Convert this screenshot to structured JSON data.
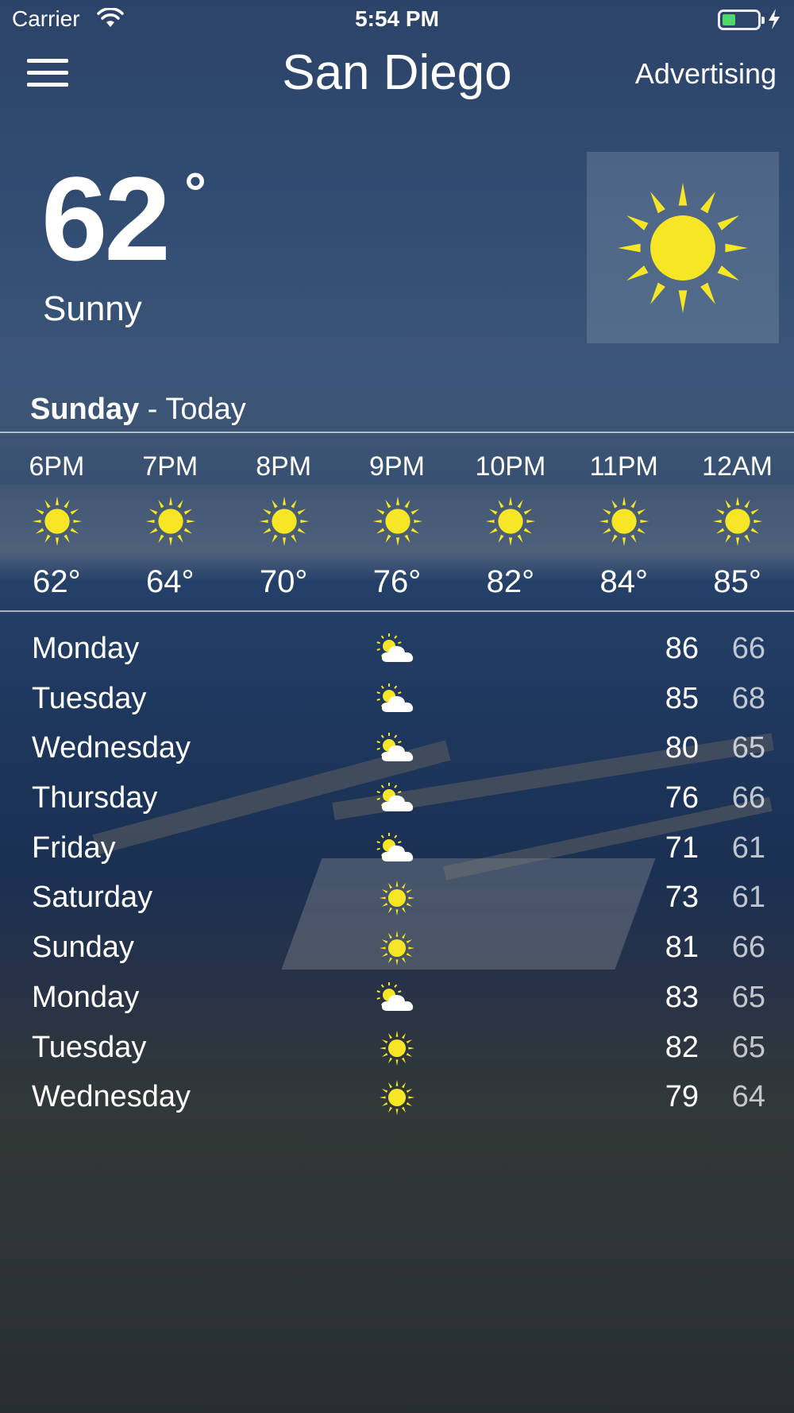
{
  "status_bar": {
    "carrier": "Carrier",
    "time": "5:54 PM",
    "battery_level": 0.35
  },
  "header": {
    "city": "San Diego",
    "advertising_label": "Advertising"
  },
  "current": {
    "temperature": "62",
    "degree_symbol": "°",
    "condition": "Sunny",
    "icon": "sun-icon"
  },
  "today": {
    "day": "Sunday",
    "suffix": " - Today"
  },
  "hourly": [
    {
      "time": "6PM",
      "temp": "62°",
      "icon": "sun-icon"
    },
    {
      "time": "7PM",
      "temp": "64°",
      "icon": "sun-icon"
    },
    {
      "time": "8PM",
      "temp": "70°",
      "icon": "sun-icon"
    },
    {
      "time": "9PM",
      "temp": "76°",
      "icon": "sun-icon"
    },
    {
      "time": "10PM",
      "temp": "82°",
      "icon": "sun-icon"
    },
    {
      "time": "11PM",
      "temp": "84°",
      "icon": "sun-icon"
    },
    {
      "time": "12AM",
      "temp": "85°",
      "icon": "sun-icon"
    }
  ],
  "daily": [
    {
      "day": "Monday",
      "high": "86",
      "low": "66",
      "icon": "partly-cloudy-icon"
    },
    {
      "day": "Tuesday",
      "high": "85",
      "low": "68",
      "icon": "partly-cloudy-icon"
    },
    {
      "day": "Wednesday",
      "high": "80",
      "low": "65",
      "icon": "partly-cloudy-icon"
    },
    {
      "day": "Thursday",
      "high": "76",
      "low": "66",
      "icon": "partly-cloudy-icon"
    },
    {
      "day": "Friday",
      "high": "71",
      "low": "61",
      "icon": "partly-cloudy-icon"
    },
    {
      "day": "Saturday",
      "high": "73",
      "low": "61",
      "icon": "sun-icon"
    },
    {
      "day": "Sunday",
      "high": "81",
      "low": "66",
      "icon": "sun-icon"
    },
    {
      "day": "Monday",
      "high": "83",
      "low": "65",
      "icon": "partly-cloudy-icon"
    },
    {
      "day": "Tuesday",
      "high": "82",
      "low": "65",
      "icon": "sun-icon"
    },
    {
      "day": "Wednesday",
      "high": "79",
      "low": "64",
      "icon": "sun-icon"
    }
  ],
  "colors": {
    "sun": "#f7e625",
    "battery": "#4cd964",
    "cloud": "#ffffff"
  }
}
